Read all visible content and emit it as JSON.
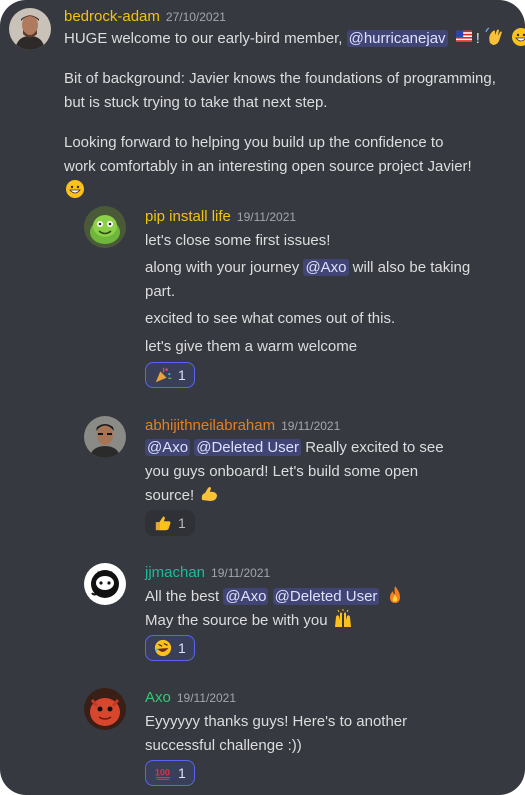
{
  "messages": [
    {
      "author": "bedrock-adam",
      "author_color": "#f1c40f",
      "timestamp": "27/10/2021",
      "line1_before": "HUGE welcome to our early-bird member, ",
      "mention": "@hurricanejav",
      "line1_after": "!",
      "para2": "Bit of background: Javier knows the foundations of programming, but is stuck trying to take that next step.",
      "para3": "Looking forward to helping you build up the confidence to work comfortably in an interesting open source project Javier!",
      "emojis": [
        "us-flag-icon",
        "waving-hand-icon",
        "grinning-face-icon",
        "grinning-face-icon"
      ]
    },
    {
      "author": "pip install life",
      "author_color": "#f1c40f",
      "timestamp": "19/11/2021",
      "lines": [
        "let's close some first issues!",
        "along with your journey ",
        "@Axo",
        " will also be taking part.",
        "excited to see what comes out of this.",
        "let's give them a warm welcome"
      ],
      "reaction": {
        "emoji": "party-popper-icon",
        "count": "1",
        "active": true
      }
    },
    {
      "author": "abhijithneilabraham",
      "author_color": "#e67e22",
      "timestamp": "19/11/2021",
      "mention1": "@Axo",
      "mention2": "@Deleted User",
      "text": " Really excited to see you guys onboard! Let's build some open source!",
      "reaction": {
        "emoji": "thumbs-up-icon",
        "count": "1",
        "active": false
      }
    },
    {
      "author": "jjmachan",
      "author_color": "#1abc9c",
      "timestamp": "19/11/2021",
      "prefix": "All the best ",
      "mention1": "@Axo",
      "mention2": "@Deleted User",
      "line2": "May the source be with you",
      "reaction": {
        "emoji": "rofl-face-icon",
        "count": "1",
        "active": true
      }
    },
    {
      "author": "Axo",
      "author_color": "#2ecc71",
      "timestamp": "19/11/2021",
      "text": "Eyyyyyy thanks guys! Here's to another successful challenge :))",
      "reaction": {
        "emoji": "hundred-points-icon",
        "count": "1",
        "active": true
      }
    }
  ],
  "colors": {
    "background": "#36393f",
    "mention_bg": "#414675",
    "reaction_active_border": "#5865f2"
  }
}
